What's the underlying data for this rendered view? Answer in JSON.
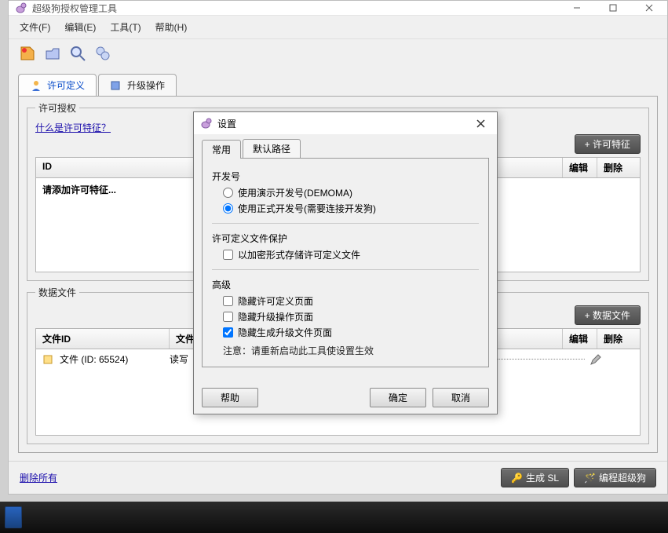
{
  "window": {
    "title": "超级狗授权管理工具"
  },
  "menu": {
    "file": "文件(F)",
    "edit": "编辑(E)",
    "tool": "工具(T)",
    "help": "帮助(H)"
  },
  "tabs": {
    "license_def": "许可定义",
    "upgrade": "升级操作"
  },
  "section_license": {
    "legend": "许可授权",
    "what_link": "什么是许可特征？",
    "btn_add_feature": "+ 许可特征",
    "col_id": "ID",
    "col_edit": "编辑",
    "col_delete": "删除",
    "placeholder": "请添加许可特征..."
  },
  "section_data": {
    "legend": "数据文件",
    "btn_add_file": "+ 数据文件",
    "col_file_id": "文件ID",
    "col_file_type": "文件类",
    "col_edit": "编辑",
    "col_delete": "删除",
    "row_file": "文件 (ID: 65524)",
    "row_type": "读写"
  },
  "footer": {
    "delete_all": "删除所有",
    "build_sl": "生成 SL",
    "program": "编程超级狗"
  },
  "dialog": {
    "title": "设置",
    "tab_general": "常用",
    "tab_path": "默认路径",
    "grp_dev": "开发号",
    "opt_demo": "使用演示开发号(DEMOMA)",
    "opt_real": "使用正式开发号(需要连接开发狗)",
    "grp_protect": "许可定义文件保护",
    "chk_encrypt": "以加密形式存储许可定义文件",
    "grp_adv": "高级",
    "chk_hide_license": "隐藏许可定义页面",
    "chk_hide_upgrade": "隐藏升级操作页面",
    "chk_hide_genfile": "隐藏生成升级文件页面",
    "note": "注意：请重新启动此工具使设置生效",
    "btn_help": "帮助",
    "btn_ok": "确定",
    "btn_cancel": "取消"
  }
}
